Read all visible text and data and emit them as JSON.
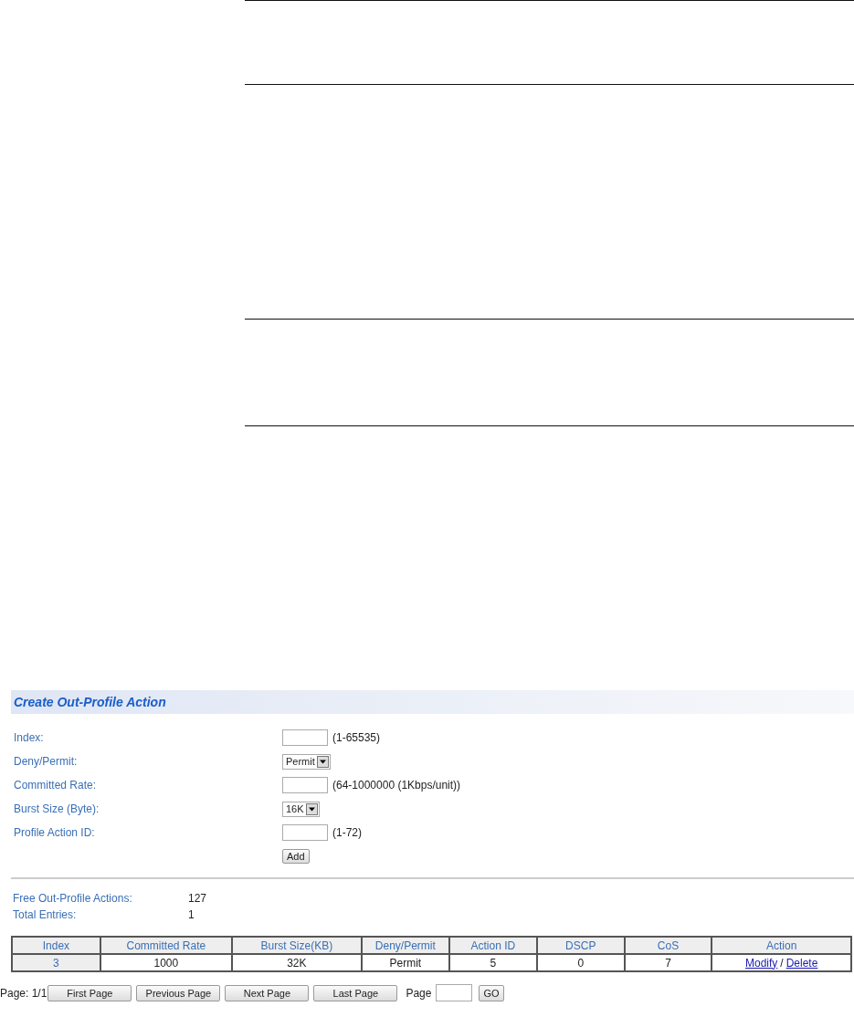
{
  "title": "Create Out-Profile Action",
  "form": [
    {
      "label": "Index:",
      "kind": "input",
      "hint": "(1-65535)"
    },
    {
      "label": "Deny/Permit:",
      "kind": "select",
      "value": "Permit"
    },
    {
      "label": "Committed Rate:",
      "kind": "input",
      "hint": "(64-1000000 (1Kbps/unit))"
    },
    {
      "label": "Burst Size (Byte):",
      "kind": "select",
      "value": "16K"
    },
    {
      "label": "Profile Action ID:",
      "kind": "input",
      "hint": "(1-72)"
    }
  ],
  "add_button": "Add",
  "stats": [
    {
      "label": "Free Out-Profile Actions:",
      "value": "127"
    },
    {
      "label": "Total Entries:",
      "value": "1"
    }
  ],
  "table": {
    "columns": [
      "Index",
      "Committed Rate",
      "Burst Size(KB)",
      "Deny/Permit",
      "Action ID",
      "DSCP",
      "CoS",
      "Action"
    ],
    "rows": [
      {
        "cells": [
          "3",
          "1000",
          "32K",
          "Permit",
          "5",
          "0",
          "7"
        ],
        "modify": "Modify",
        "separator": "/",
        "delete": "Delete"
      }
    ]
  },
  "pager": {
    "page_info": "Page: 1/1",
    "buttons": [
      "First Page",
      "Previous Page",
      "Next Page",
      "Last Page"
    ],
    "page_label": "Page",
    "go": "GO"
  }
}
